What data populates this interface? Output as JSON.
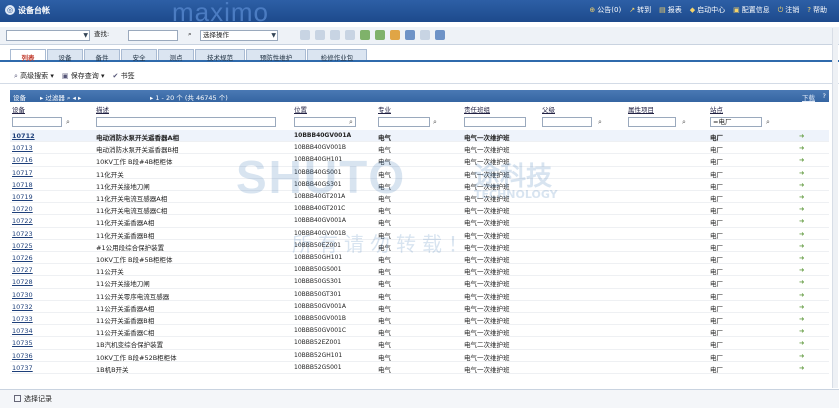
{
  "titlebar": {
    "title": "设备台帐",
    "brand": "maximo",
    "links": [
      {
        "icon": "⊕",
        "label": "公告(0)"
      },
      {
        "icon": "↗",
        "label": "转到"
      },
      {
        "icon": "▤",
        "label": "报表"
      },
      {
        "icon": "◆",
        "label": "启动中心"
      },
      {
        "icon": "▣",
        "label": "配置信息"
      },
      {
        "icon": "⏻",
        "label": "注销"
      },
      {
        "icon": "?",
        "label": "帮助"
      }
    ]
  },
  "toolbar": {
    "query_label": "查找:",
    "action_select": "选择操作"
  },
  "tabs": [
    "列表",
    "设备",
    "备件",
    "安全",
    "测点",
    "技术规范",
    "预防性维护",
    "检修作业包"
  ],
  "searchbar": {
    "advanced_search": "高级搜索",
    "save_query": "保存查询",
    "bookmark": "书签"
  },
  "table": {
    "title": "设备",
    "filter": "过滤器",
    "count": "1 - 20 个 (共 46745 个)",
    "download": "下载",
    "columns": [
      "设备",
      "描述",
      "位置",
      "专业",
      "责任班组",
      "父级",
      "属性项目",
      "站点"
    ],
    "filter_site": "=电厂",
    "rows": [
      {
        "id": "10712",
        "desc": "电动消防水泵开关遥香器A相",
        "loc": "10BBB40GV001A",
        "spec": "电气",
        "resp": "电气一次维护班",
        "site": "电厂"
      },
      {
        "id": "10713",
        "desc": "电动消防水泵开关遥香器B相",
        "loc": "10BBB40GV001B",
        "spec": "电气",
        "resp": "电气一次维护班",
        "site": "电厂"
      },
      {
        "id": "10716",
        "desc": "10KV工作 B段#4B柜柜体",
        "loc": "10BBB40GH101",
        "spec": "电气",
        "resp": "电气一次维护班",
        "site": "电厂"
      },
      {
        "id": "10717",
        "desc": "11化开关",
        "loc": "10BBB40GS001",
        "spec": "电气",
        "resp": "电气一次维护班",
        "site": "电厂"
      },
      {
        "id": "10718",
        "desc": "11化开关接地刀闸",
        "loc": "10BBB40GS301",
        "spec": "电气",
        "resp": "电气一次维护班",
        "site": "电厂"
      },
      {
        "id": "10719",
        "desc": "11化开关电流互感器A相",
        "loc": "10BBB40GT201A",
        "spec": "电气",
        "resp": "电气一次维护班",
        "site": "电厂"
      },
      {
        "id": "10720",
        "desc": "11化开关电流互感器C相",
        "loc": "10BBB40GT201C",
        "spec": "电气",
        "resp": "电气一次维护班",
        "site": "电厂"
      },
      {
        "id": "10722",
        "desc": "11化开关遥香器A相",
        "loc": "10BBB40GV001A",
        "spec": "电气",
        "resp": "电气一次维护班",
        "site": "电厂"
      },
      {
        "id": "10723",
        "desc": "11化开关遥香器B相",
        "loc": "10BBB40GV001B",
        "spec": "电气",
        "resp": "电气一次维护班",
        "site": "电厂"
      },
      {
        "id": "10725",
        "desc": "#1公用段综合保护装置",
        "loc": "10BBB50EZ001",
        "spec": "电气",
        "resp": "电气一次维护班",
        "site": "电厂"
      },
      {
        "id": "10726",
        "desc": "10KV工作 B段#5B柜柜体",
        "loc": "10BBB50GH101",
        "spec": "电气",
        "resp": "电气一次维护班",
        "site": "电厂"
      },
      {
        "id": "10727",
        "desc": "11公开关",
        "loc": "10BBB50GS001",
        "spec": "电气",
        "resp": "电气一次维护班",
        "site": "电厂"
      },
      {
        "id": "10728",
        "desc": "11公开关接地刀闸",
        "loc": "10BBB50GS301",
        "spec": "电气",
        "resp": "电气一次维护班",
        "site": "电厂"
      },
      {
        "id": "10730",
        "desc": "11公开关零序电流互感器",
        "loc": "10BBB50GT301",
        "spec": "电气",
        "resp": "电气一次维护班",
        "site": "电厂"
      },
      {
        "id": "10732",
        "desc": "11公开关遥香器A相",
        "loc": "10BBB50GV001A",
        "spec": "电气",
        "resp": "电气一次维护班",
        "site": "电厂"
      },
      {
        "id": "10733",
        "desc": "11公开关遥香器B相",
        "loc": "10BBB50GV001B",
        "spec": "电气",
        "resp": "电气一次维护班",
        "site": "电厂"
      },
      {
        "id": "10734",
        "desc": "11公开关遥香器C相",
        "loc": "10BBB50GV001C",
        "spec": "电气",
        "resp": "电气一次维护班",
        "site": "电厂"
      },
      {
        "id": "10735",
        "desc": "1B汽机变综合保护装置",
        "loc": "10BBB52EZ001",
        "spec": "电气",
        "resp": "电气二次维护班",
        "site": "电厂"
      },
      {
        "id": "10736",
        "desc": "10KV工作 B段#52B柜柜体",
        "loc": "10BBB52GH101",
        "spec": "电气",
        "resp": "电气一次维护班",
        "site": "电厂"
      },
      {
        "id": "10737",
        "desc": "1B机B开关",
        "loc": "10BBB52GS001",
        "spec": "电气",
        "resp": "电气一次维护班",
        "site": "电厂"
      }
    ]
  },
  "watermark": {
    "logo": "SHUTO",
    "cn": "途科技",
    "en": "TECHNOLOGY",
    "note": "所有请勿转载！"
  },
  "footer": {
    "select_records": "选择记录"
  }
}
